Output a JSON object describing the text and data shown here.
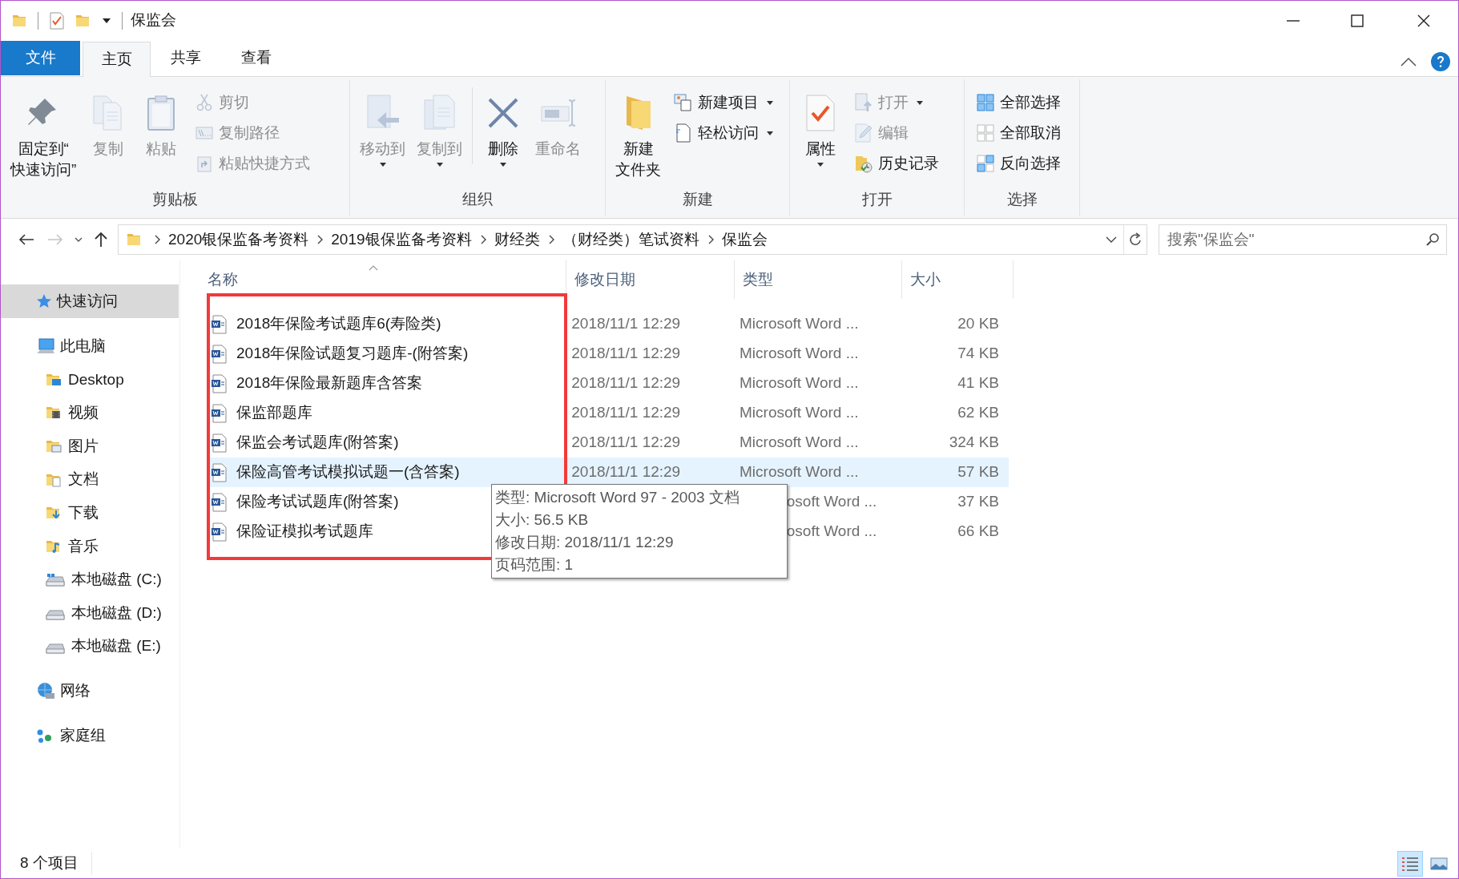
{
  "window": {
    "title": "保监会"
  },
  "ribbon_tabs": [
    {
      "label": "文件",
      "kind": "file",
      "selected": false
    },
    {
      "label": "主页",
      "kind": "tab",
      "selected": true
    },
    {
      "label": "共享",
      "kind": "tab",
      "selected": false
    },
    {
      "label": "查看",
      "kind": "tab",
      "selected": false
    }
  ],
  "ribbon_groups": [
    {
      "label": "剪贴板",
      "items": [
        {
          "kind": "large",
          "label_lines": [
            "固定到“",
            "快速访问”"
          ],
          "disabled": false,
          "dropdown": false
        },
        {
          "kind": "large",
          "label_lines": [
            "复制"
          ],
          "disabled": true,
          "dropdown": false
        },
        {
          "kind": "large",
          "label_lines": [
            "粘贴"
          ],
          "disabled": true,
          "dropdown": false
        },
        {
          "kind": "small",
          "label": "剪切",
          "disabled": true,
          "dropdown": false
        },
        {
          "kind": "small",
          "label": "复制路径",
          "disabled": true,
          "dropdown": false
        },
        {
          "kind": "small",
          "label": "粘贴快捷方式",
          "disabled": true,
          "dropdown": false
        }
      ]
    },
    {
      "label": "组织",
      "items": [
        {
          "kind": "large",
          "label_lines": [
            "移动到"
          ],
          "disabled": true,
          "dropdown": true
        },
        {
          "kind": "large",
          "label_lines": [
            "复制到"
          ],
          "disabled": true,
          "dropdown": true
        },
        {
          "kind": "large",
          "label_lines": [
            "删除"
          ],
          "disabled": false,
          "dropdown": true
        },
        {
          "kind": "large",
          "label_lines": [
            "重命名"
          ],
          "disabled": true,
          "dropdown": false
        }
      ]
    },
    {
      "label": "新建",
      "items": [
        {
          "kind": "large",
          "label_lines": [
            "新建",
            "文件夹"
          ],
          "disabled": false,
          "dropdown": false
        },
        {
          "kind": "small",
          "label": "新建项目",
          "disabled": false,
          "dropdown": true
        },
        {
          "kind": "small",
          "label": "轻松访问",
          "disabled": false,
          "dropdown": true
        }
      ]
    },
    {
      "label": "打开",
      "items": [
        {
          "kind": "large",
          "label_lines": [
            "属性"
          ],
          "disabled": false,
          "dropdown": true
        },
        {
          "kind": "small",
          "label": "打开",
          "disabled": true,
          "dropdown": true
        },
        {
          "kind": "small",
          "label": "编辑",
          "disabled": true,
          "dropdown": false
        },
        {
          "kind": "small",
          "label": "历史记录",
          "disabled": false,
          "dropdown": false
        }
      ]
    },
    {
      "label": "选择",
      "items": [
        {
          "kind": "small",
          "label": "全部选择",
          "disabled": false,
          "dropdown": false
        },
        {
          "kind": "small",
          "label": "全部取消",
          "disabled": false,
          "dropdown": false
        },
        {
          "kind": "small",
          "label": "反向选择",
          "disabled": false,
          "dropdown": false
        }
      ]
    }
  ],
  "address_bar": {
    "back": {
      "disabled": false
    },
    "forward": {
      "disabled": true
    },
    "breadcrumbs": [
      "2020银保监备考资料",
      "2019银保监备考资料",
      "财经类",
      "（财经类）笔试资料",
      "保监会"
    ],
    "search": {
      "placeholder": "搜索\"保监会\""
    }
  },
  "navigation": [
    {
      "label": "快速访问",
      "selected": true
    },
    {
      "label": "此电脑",
      "selected": false,
      "children": [
        {
          "label": "Desktop",
          "selected": false
        },
        {
          "label": "视频",
          "selected": false
        },
        {
          "label": "图片",
          "selected": false
        },
        {
          "label": "文档",
          "selected": false
        },
        {
          "label": "下载",
          "selected": false
        },
        {
          "label": "音乐",
          "selected": false
        },
        {
          "label": "本地磁盘 (C:)",
          "selected": false
        },
        {
          "label": "本地磁盘 (D:)",
          "selected": false
        },
        {
          "label": "本地磁盘 (E:)",
          "selected": false
        }
      ]
    },
    {
      "label": "网络",
      "selected": false
    },
    {
      "label": "家庭组",
      "selected": false
    }
  ],
  "columns": [
    {
      "label": "名称",
      "sorted": true
    },
    {
      "label": "修改日期",
      "sorted": false
    },
    {
      "label": "类型",
      "sorted": false
    },
    {
      "label": "大小",
      "sorted": false
    }
  ],
  "files": [
    {
      "name": "2018年保险考试题库6(寿险类)",
      "date": "2018/11/1 12:29",
      "type": "Microsoft Word ...",
      "size": "20 KB",
      "highlighted": false,
      "type_partly_covered": false
    },
    {
      "name": "2018年保险试题复习题库-(附答案)",
      "date": "2018/11/1 12:29",
      "type": "Microsoft Word ...",
      "size": "74 KB",
      "highlighted": false,
      "type_partly_covered": false
    },
    {
      "name": "2018年保险最新题库含答案",
      "date": "2018/11/1 12:29",
      "type": "Microsoft Word ...",
      "size": "41 KB",
      "highlighted": false,
      "type_partly_covered": false
    },
    {
      "name": "保监部题库",
      "date": "2018/11/1 12:29",
      "type": "Microsoft Word ...",
      "size": "62 KB",
      "highlighted": false,
      "type_partly_covered": false
    },
    {
      "name": "保监会考试题库(附答案)",
      "date": "2018/11/1 12:29",
      "type": "Microsoft Word ...",
      "size": "324 KB",
      "highlighted": false,
      "type_partly_covered": false
    },
    {
      "name": "保险高管考试模拟试题一(含答案)",
      "date": "2018/11/1 12:29",
      "type": "Microsoft Word ...",
      "size": "57 KB",
      "highlighted": true,
      "type_partly_covered": false
    },
    {
      "name": "保险考试试题库(附答案)",
      "type": "osoft Word ...",
      "size": "37 KB",
      "highlighted": false,
      "type_partly_covered": true
    },
    {
      "name": "保险证模拟考试题库",
      "type": "osoft Word ...",
      "size": "66 KB",
      "highlighted": false,
      "type_partly_covered": true
    }
  ],
  "tooltip": {
    "lines": [
      "类型: Microsoft Word 97 - 2003 文档",
      "大小: 56.5 KB",
      "修改日期: 2018/11/1 12:29",
      "页码范围: 1"
    ]
  },
  "status_bar": {
    "count": "8 个项目",
    "views": [
      {
        "kind": "details",
        "selected": true
      },
      {
        "kind": "large-icons",
        "selected": false
      }
    ]
  }
}
